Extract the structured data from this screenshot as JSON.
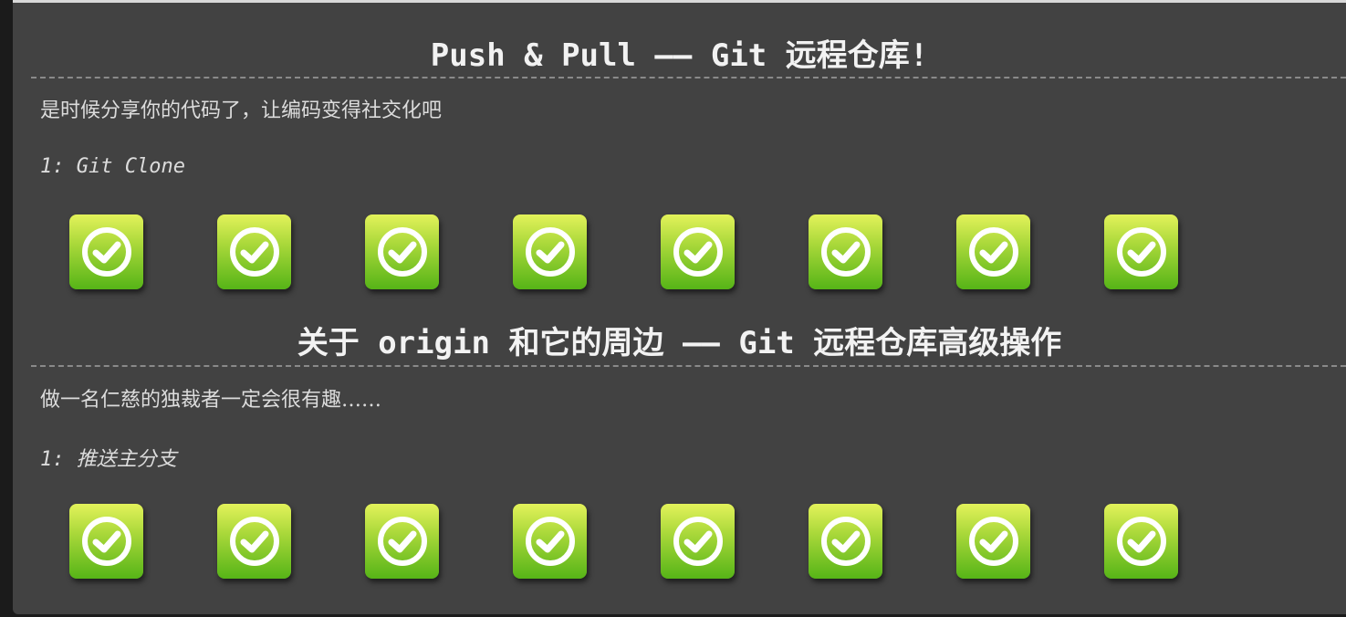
{
  "sections": [
    {
      "title": "Push & Pull —— Git 远程仓库!",
      "description": "是时候分享你的代码了，让编码变得社交化吧",
      "subsection": "1: Git Clone",
      "levels": [
        {
          "status": "completed",
          "icon": "check-circle-icon"
        },
        {
          "status": "completed",
          "icon": "check-circle-icon"
        },
        {
          "status": "completed",
          "icon": "check-circle-icon"
        },
        {
          "status": "completed",
          "icon": "check-circle-icon"
        },
        {
          "status": "completed",
          "icon": "check-circle-icon"
        },
        {
          "status": "completed",
          "icon": "check-circle-icon"
        },
        {
          "status": "completed",
          "icon": "check-circle-icon"
        },
        {
          "status": "completed",
          "icon": "check-circle-icon"
        }
      ]
    },
    {
      "title": "关于 origin 和它的周边 —— Git 远程仓库高级操作",
      "description": "做一名仁慈的独裁者一定会很有趣……",
      "subsection": "1: 推送主分支",
      "levels": [
        {
          "status": "completed",
          "icon": "check-circle-icon"
        },
        {
          "status": "completed",
          "icon": "check-circle-icon"
        },
        {
          "status": "completed",
          "icon": "check-circle-icon"
        },
        {
          "status": "completed",
          "icon": "check-circle-icon"
        },
        {
          "status": "completed",
          "icon": "check-circle-icon"
        },
        {
          "status": "completed",
          "icon": "check-circle-icon"
        },
        {
          "status": "completed",
          "icon": "check-circle-icon"
        },
        {
          "status": "completed",
          "icon": "check-circle-icon"
        }
      ]
    }
  ],
  "colors": {
    "panel_bg": "#424242",
    "level_gradient_top": "#e3f25a",
    "level_gradient_bottom": "#56b417",
    "check_stroke": "#ffffff"
  }
}
